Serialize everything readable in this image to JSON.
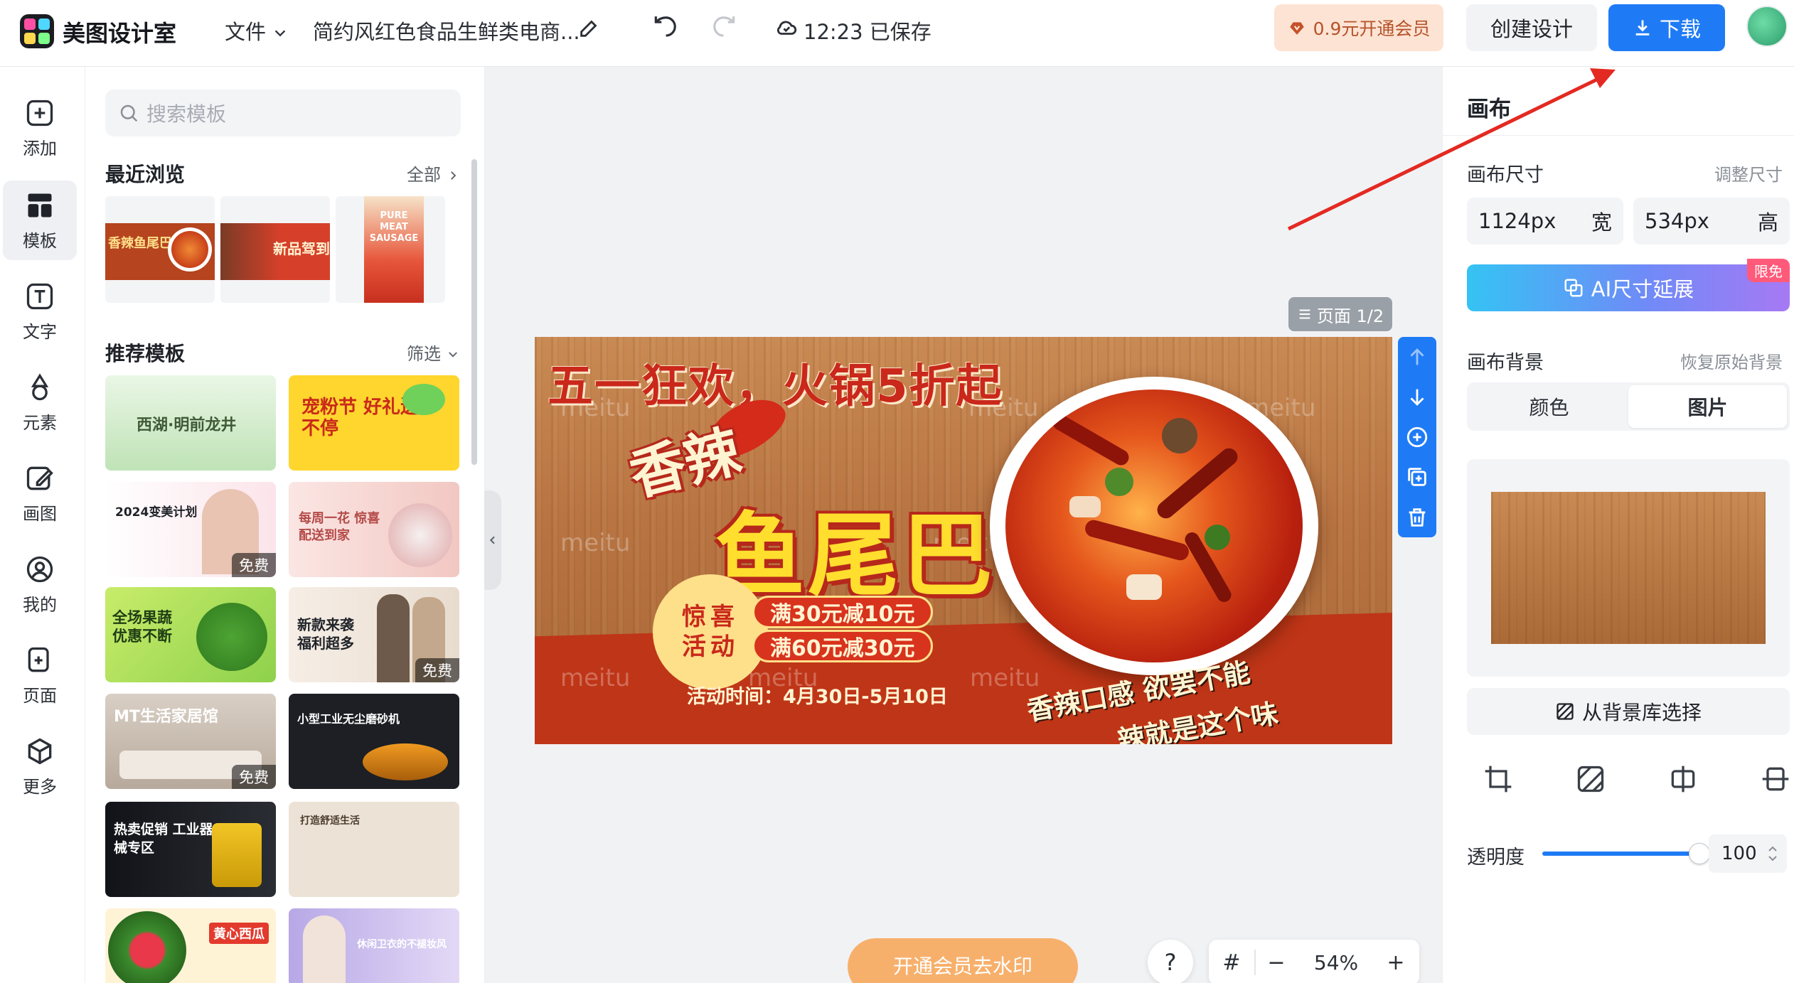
{
  "topbar": {
    "app_title": "美图设计室",
    "file_menu": "文件",
    "doc_title": "简约风红色食品生鲜类电商...",
    "save_status": "12:23 已保存",
    "vip_label": "0.9元开通会员",
    "create_label": "创建设计",
    "download_label": "下载"
  },
  "rail": {
    "items": [
      {
        "label": "添加",
        "icon": "add-icon"
      },
      {
        "label": "模板",
        "icon": "template-icon"
      },
      {
        "label": "文字",
        "icon": "text-icon"
      },
      {
        "label": "元素",
        "icon": "element-icon"
      },
      {
        "label": "画图",
        "icon": "draw-icon"
      },
      {
        "label": "我的",
        "icon": "user-icon"
      },
      {
        "label": "页面",
        "icon": "page-icon"
      },
      {
        "label": "更多",
        "icon": "more-icon"
      }
    ]
  },
  "panel": {
    "search_placeholder": "搜索模板",
    "recent_title": "最近浏览",
    "recent_all": "全部",
    "recent_thumbs": [
      {
        "text": "香辣鱼尾巴"
      },
      {
        "text": "新品驾到"
      },
      {
        "text": "PURE MEAT SAUSAGE"
      }
    ],
    "recommend_title": "推荐模板",
    "filter_label": "筛选",
    "free_label": "免费",
    "templates": [
      {
        "text": "西湖·明前龙井"
      },
      {
        "text": "宠粉节 好礼送不停"
      },
      {
        "text": "2024变美计划"
      },
      {
        "text": "每周一花 惊喜配送到家"
      },
      {
        "text": "全场果蔬 优惠不断"
      },
      {
        "text": "新款来袭 福利超多"
      },
      {
        "text": "MT生活家居馆"
      },
      {
        "text": "小型工业无尘磨砂机"
      },
      {
        "text": "热卖促销 工业器械专区"
      },
      {
        "text": "打造舒适生活"
      },
      {
        "text": "黄心西瓜"
      },
      {
        "text": "休闲卫衣的不褪妆风"
      }
    ]
  },
  "canvas": {
    "page_indicator": "页面 1/2",
    "watermark": "meitu",
    "title": "五一狂欢，火锅5折起",
    "sub1": "香辣",
    "sub2": "鱼尾巴",
    "promo_circle_line1": "惊喜",
    "promo_circle_line2": "活动",
    "promo1": "满30元减10元",
    "promo2": "满60元减30元",
    "date": "活动时间：4月30日-5月10日",
    "slogan1": "香辣口感 欲罢不能",
    "slogan2": "辣就是这个味"
  },
  "bottom": {
    "watermark_btn": "开通会员去水印",
    "help": "?",
    "grid": "#",
    "zoom_minus": "−",
    "zoom": "54%",
    "zoom_plus": "+"
  },
  "right": {
    "title": "画布",
    "size_label": "画布尺寸",
    "resize_link": "调整尺寸",
    "width_value": "1124px",
    "width_unit": "宽",
    "height_value": "534px",
    "height_unit": "高",
    "ai_btn": "AI尺寸延展",
    "limited_badge": "限免",
    "bg_label": "画布背景",
    "restore_link": "恢复原始背景",
    "tab_color": "颜色",
    "tab_image": "图片",
    "library_btn": "从背景库选择",
    "opacity_label": "透明度",
    "opacity_value": "100",
    "opacity": 1.0
  },
  "colors": {
    "primary": "#1f7bf5",
    "vip_bg": "#fde3d3",
    "canvas_red": "#c9281b",
    "annotation_arrow": "#e32a22"
  }
}
